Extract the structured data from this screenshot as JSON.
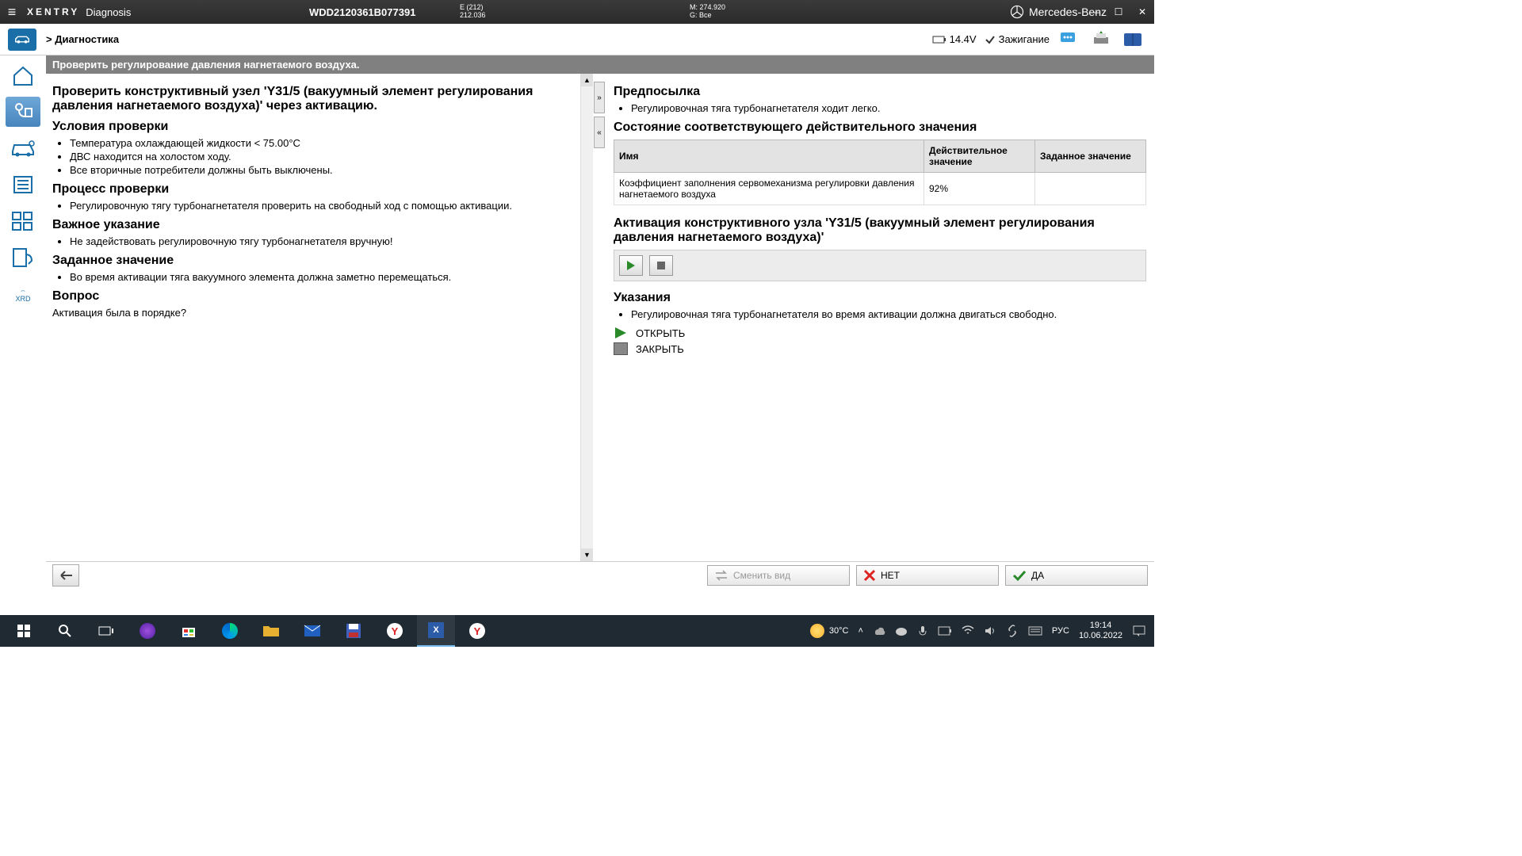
{
  "titlebar": {
    "brand": "XENTRY",
    "product": "Diagnosis",
    "vin": "WDD2120361B077391",
    "e_line1": "E (212)",
    "e_line2": "212.036",
    "m_line": "M: 274.920",
    "g_line": "G: Все",
    "mb_brand": "Mercedes-Benz"
  },
  "crumb": {
    "text": "> Диагностика",
    "voltage": "14.4V",
    "ignition": "Зажигание"
  },
  "banner": "Проверить регулирование давления нагнетаемого воздуха.",
  "left": {
    "h1": "Проверить конструктивный узел 'Y31/5 (вакуумный элемент регулирования давления нагнетаемого воздуха)' через активацию.",
    "h_conditions": "Условия проверки",
    "conditions": [
      "Температура охлаждающей жидкости < 75.00°C",
      "ДВС находится на холостом ходу.",
      "Все вторичные потребители должны быть выключены."
    ],
    "h_process": "Процесс проверки",
    "process": [
      "Регулировочную тягу турбонагнетателя проверить на свободный ход с помощью активации."
    ],
    "h_note": "Важное указание",
    "note": [
      "Не задействовать регулировочную тягу турбонагнетателя вручную!"
    ],
    "h_target": "Заданное значение",
    "target": [
      "Во время активации тяга вакуумного элемента должна заметно перемещаться."
    ],
    "h_question": "Вопрос",
    "question": "Активация была в порядке?"
  },
  "right": {
    "h_prereq": "Предпосылка",
    "prereq": [
      "Регулировочная тяга турбонагнетателя ходит легко."
    ],
    "h_state": "Состояние соответствующего действительного значения",
    "tbl_h1": "Имя",
    "tbl_h2": "Действительное значение",
    "tbl_h3": "Заданное значение",
    "row_name": "Коэффициент заполнения сервомеханизма регулировки давления нагнетаемого воздуха",
    "row_actual": "92%",
    "row_target": "",
    "h_activation": "Активация конструктивного узла 'Y31/5 (вакуумный элемент регулирования давления нагнетаемого воздуха)'",
    "h_hints": "Указания",
    "hints": [
      "Регулировочная тяга турбонагнетателя во время активации должна двигаться свободно."
    ],
    "legend_open": "ОТКРЫТЬ",
    "legend_close": "ЗАКРЫТЬ"
  },
  "bottom": {
    "switch_view": "Сменить вид",
    "no": "НЕТ",
    "yes": "ДА"
  },
  "taskbar": {
    "temp": "30°C",
    "lang": "РУС",
    "time": "19:14",
    "date": "10.06.2022"
  }
}
